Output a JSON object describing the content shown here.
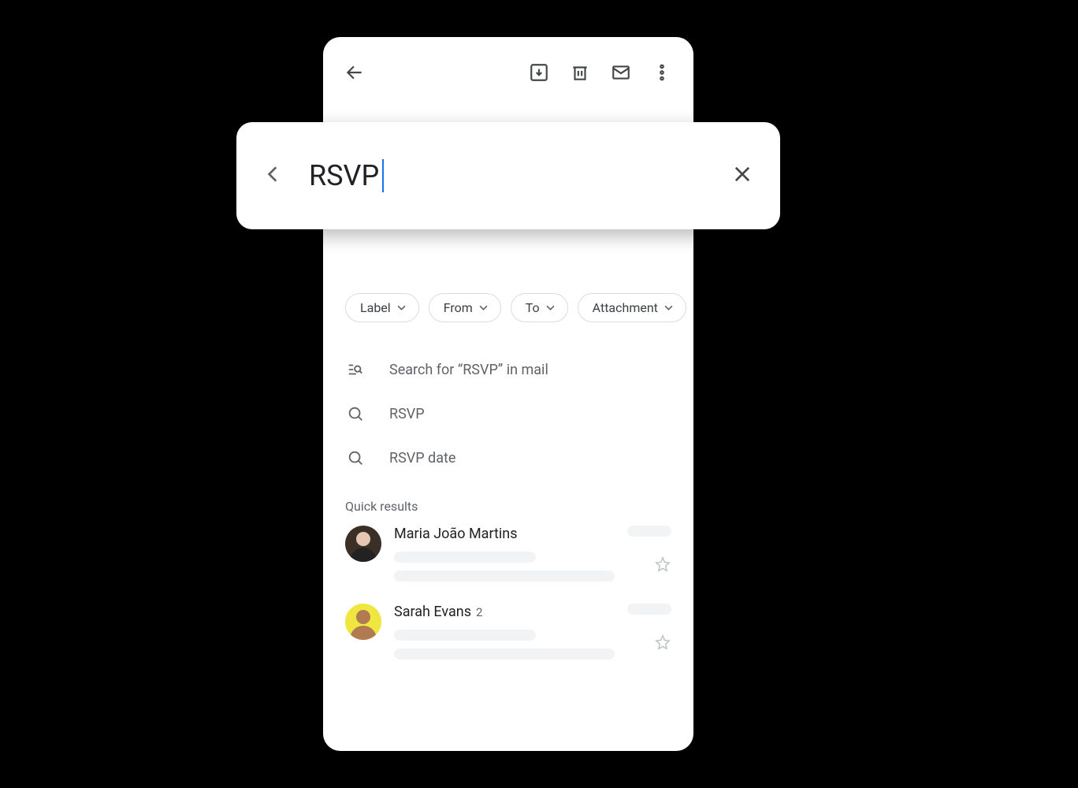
{
  "appbar": {},
  "search": {
    "query": "RSVP"
  },
  "chips": [
    {
      "label": "Label"
    },
    {
      "label": "From"
    },
    {
      "label": "To"
    },
    {
      "label": "Attachment"
    }
  ],
  "suggestions": {
    "full_search": "Search for “RSVP” in mail",
    "items": [
      "RSVP",
      "RSVP date"
    ]
  },
  "quick_results_header": "Quick results",
  "results": [
    {
      "name": "Maria João Martins",
      "count": ""
    },
    {
      "name": "Sarah Evans",
      "count": "2"
    }
  ]
}
